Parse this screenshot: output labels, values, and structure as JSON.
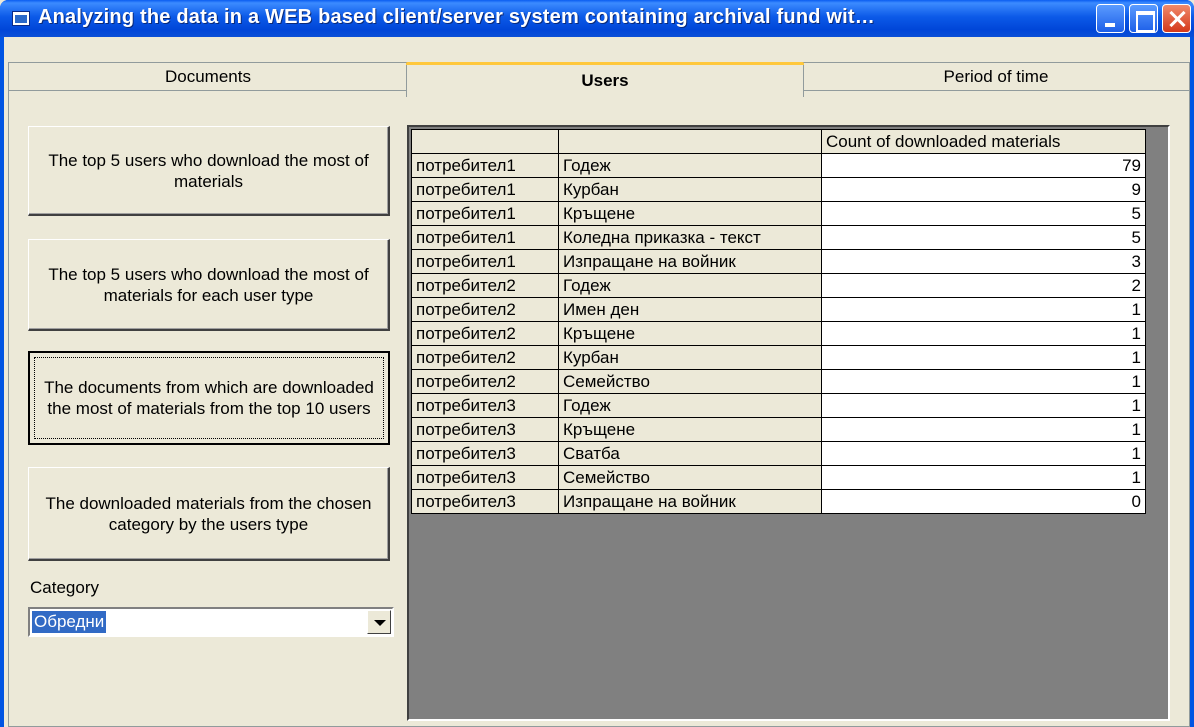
{
  "window": {
    "title": "Analyzing the data in a WEB based client/server system containing archival fund wit…"
  },
  "tabs": [
    {
      "label": "Documents"
    },
    {
      "label": "Users"
    },
    {
      "label": "Period of time"
    }
  ],
  "buttons": [
    {
      "label": "The top 5 users who download the most of materials"
    },
    {
      "label": "The top 5 users who download the most of materials for each user type"
    },
    {
      "label": "The documents from which are downloaded the most of materials from the top 10 users"
    },
    {
      "label": "The downloaded materials from the chosen category by the users type"
    }
  ],
  "category": {
    "label": "Category",
    "selected": "Обредни"
  },
  "grid": {
    "headers": [
      "",
      "",
      "Count of downloaded materials"
    ],
    "rows": [
      [
        "потребител1",
        "Годеж",
        "79"
      ],
      [
        "потребител1",
        "Курбан",
        "9"
      ],
      [
        "потребител1",
        "Кръщене",
        "5"
      ],
      [
        "потребител1",
        "Коледна приказка - текст",
        "5"
      ],
      [
        "потребител1",
        "Изпращане на войник",
        "3"
      ],
      [
        "потребител2",
        "Годеж",
        "2"
      ],
      [
        "потребител2",
        "Имен ден",
        "1"
      ],
      [
        "потребител2",
        "Кръщене",
        "1"
      ],
      [
        "потребител2",
        "Курбан",
        "1"
      ],
      [
        "потребител2",
        "Семейство",
        "1"
      ],
      [
        "потребител3",
        "Годеж",
        "1"
      ],
      [
        "потребител3",
        "Кръщене",
        "1"
      ],
      [
        "потребител3",
        "Сватба",
        "1"
      ],
      [
        "потребител3",
        "Семейство",
        "1"
      ],
      [
        "потребител3",
        "Изпращане на войник",
        "0"
      ]
    ]
  }
}
